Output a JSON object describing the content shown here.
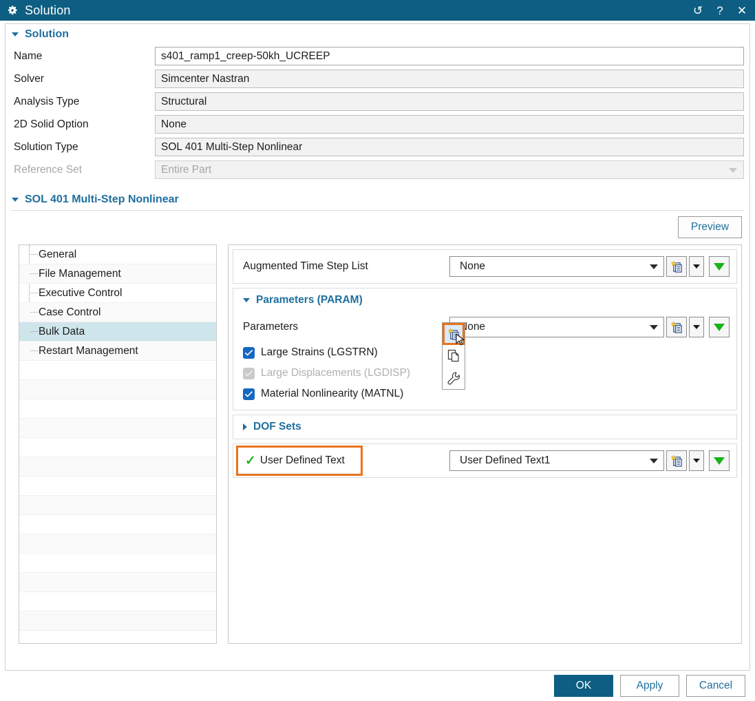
{
  "titlebar": {
    "icon": "gear-icon",
    "title": "Solution",
    "reset_label": "↺",
    "help_label": "?",
    "close_label": "✕"
  },
  "solution_group": {
    "header": "Solution",
    "rows": [
      {
        "label": "Name",
        "value": "s401_ramp1_creep-50kh_UCREEP",
        "type": "text",
        "disabled": false
      },
      {
        "label": "Solver",
        "value": "Simcenter Nastran",
        "type": "readonly",
        "disabled": false
      },
      {
        "label": "Analysis Type",
        "value": "Structural",
        "type": "readonly",
        "disabled": false
      },
      {
        "label": "2D Solid Option",
        "value": "None",
        "type": "readonly",
        "disabled": false
      },
      {
        "label": "Solution Type",
        "value": "SOL 401 Multi-Step Nonlinear",
        "type": "readonly",
        "disabled": false
      },
      {
        "label": "Reference Set",
        "value": "Entire Part",
        "type": "combo",
        "disabled": true
      }
    ]
  },
  "sol_group": {
    "header": "SOL 401 Multi-Step Nonlinear",
    "preview_label": "Preview"
  },
  "tree": {
    "items": [
      {
        "label": "General",
        "selected": false
      },
      {
        "label": "File Management",
        "selected": false
      },
      {
        "label": "Executive Control",
        "selected": false
      },
      {
        "label": "Case Control",
        "selected": false
      },
      {
        "label": "Bulk Data",
        "selected": true
      },
      {
        "label": "Restart Management",
        "selected": false
      }
    ],
    "empty_row_count": 15,
    "selected_color": "#cfe5ec"
  },
  "panel": {
    "augmented": {
      "label": "Augmented Time Step List",
      "value": "None",
      "new_icon": "new-object-icon",
      "more_icon": "chevron-down-icon",
      "green_icon": "green-down-arrow-icon"
    },
    "param_section": {
      "header": "Parameters (PARAM)",
      "parameters_label": "Parameters",
      "parameters_value": "None",
      "checkboxes": [
        {
          "label": "Large Strains (LGSTRN)",
          "checked": true,
          "disabled": false
        },
        {
          "label": "Large Displacements (LGDISP)",
          "checked": true,
          "disabled": true
        },
        {
          "label": "Material Nonlinearity (MATNL)",
          "checked": true,
          "disabled": false
        }
      ]
    },
    "dof_sets": {
      "header": "DOF Sets",
      "expanded": false
    },
    "user_defined_text": {
      "check_glyph": "✓",
      "label": "User Defined Text",
      "value": "User Defined Text1",
      "highlight_color": "#e8731c"
    },
    "flyout": {
      "items": [
        {
          "icon": "new-object-icon",
          "active": true
        },
        {
          "icon": "copy-icon",
          "active": false
        },
        {
          "icon": "wrench-icon",
          "active": false
        }
      ]
    }
  },
  "footer": {
    "ok": "OK",
    "apply": "Apply",
    "cancel": "Cancel"
  },
  "colors": {
    "titlebar": "#0d5e82",
    "accent_blue": "#1f6f9e",
    "highlight_orange": "#e8731c",
    "check_green": "#21b421",
    "checkbox_blue": "#1668c0"
  }
}
